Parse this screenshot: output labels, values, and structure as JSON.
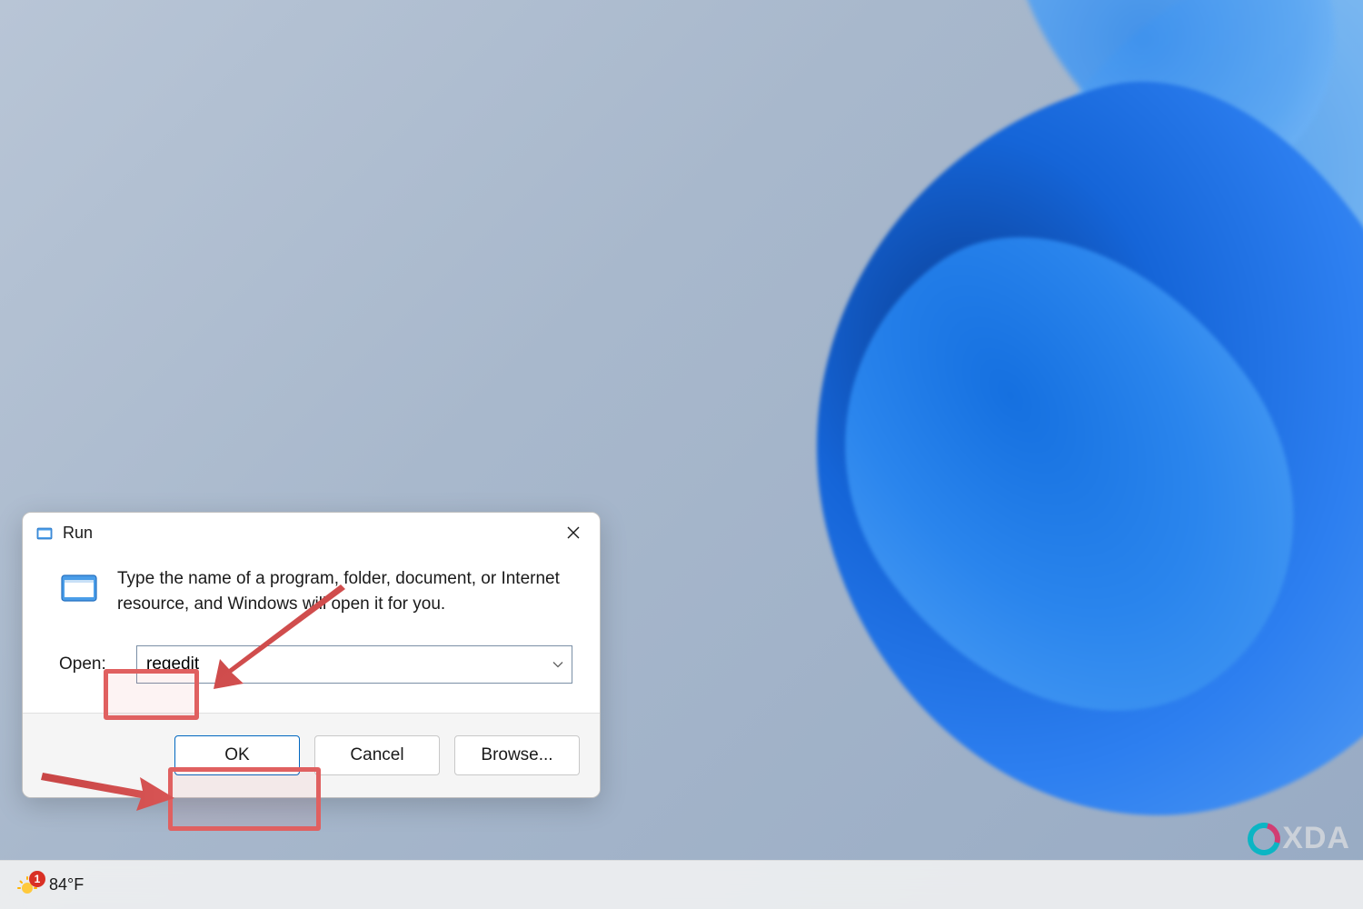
{
  "dialog": {
    "title": "Run",
    "description": "Type the name of a program, folder, document, or Internet resource, and Windows will open it for you.",
    "open_label": "Open:",
    "input_value": "regedit",
    "buttons": {
      "ok": "OK",
      "cancel": "Cancel",
      "browse": "Browse..."
    }
  },
  "taskbar": {
    "weather": {
      "temp": "84°F",
      "badge": "1"
    }
  },
  "watermark": {
    "text": "XDA"
  }
}
